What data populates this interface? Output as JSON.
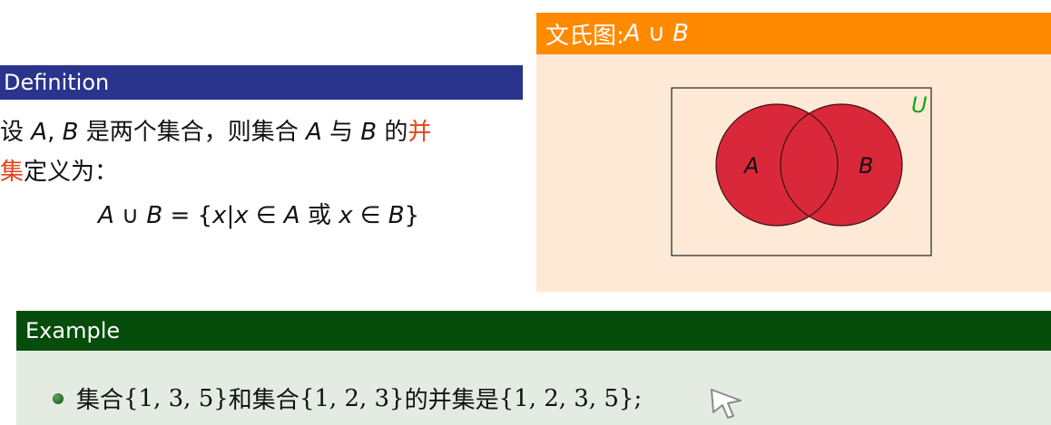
{
  "definition": {
    "title": "Definition",
    "line1": {
      "p1": "设 ",
      "var_a": "A",
      "comma": ", ",
      "var_b": "B",
      "p2": " 是两个集合，则集合 ",
      "var_a2": "A",
      "p3": " 与 ",
      "var_b2": "B",
      "p4": " 的",
      "highlight": "并"
    },
    "line2": {
      "highlight": "集",
      "rest": "定义为："
    },
    "formula": {
      "lhs": "A ∪ B",
      "eq": " = {",
      "x1": "x",
      "bar": "|",
      "x2": "x",
      "in1": " ∈ ",
      "a": "A",
      "or": " 或 ",
      "x3": "x",
      "in2": " ∈ ",
      "b": "B",
      "close": "}"
    }
  },
  "venn": {
    "title_prefix": "文氏图:",
    "title_math": "A ∪ B",
    "universe_label": "U",
    "set_a_label": "A",
    "set_b_label": "B",
    "colors": {
      "header": "#ff8a00",
      "body": "#fde9d6",
      "circle_fill": "#d9283a",
      "universe_label": "#1aa61a"
    }
  },
  "example": {
    "title": "Example",
    "item": {
      "p1": "集合 ",
      "set1": "{1, 3, 5}",
      "p2": " 和集合 ",
      "set2": "{1, 2, 3}",
      "p3": " 的并集是 ",
      "set3": "{1, 2, 3, 5};"
    }
  },
  "colors": {
    "definition_header": "#2a348c",
    "example_header": "#064d0b",
    "example_body": "#e4ebe3",
    "highlight": "#e2441a"
  }
}
